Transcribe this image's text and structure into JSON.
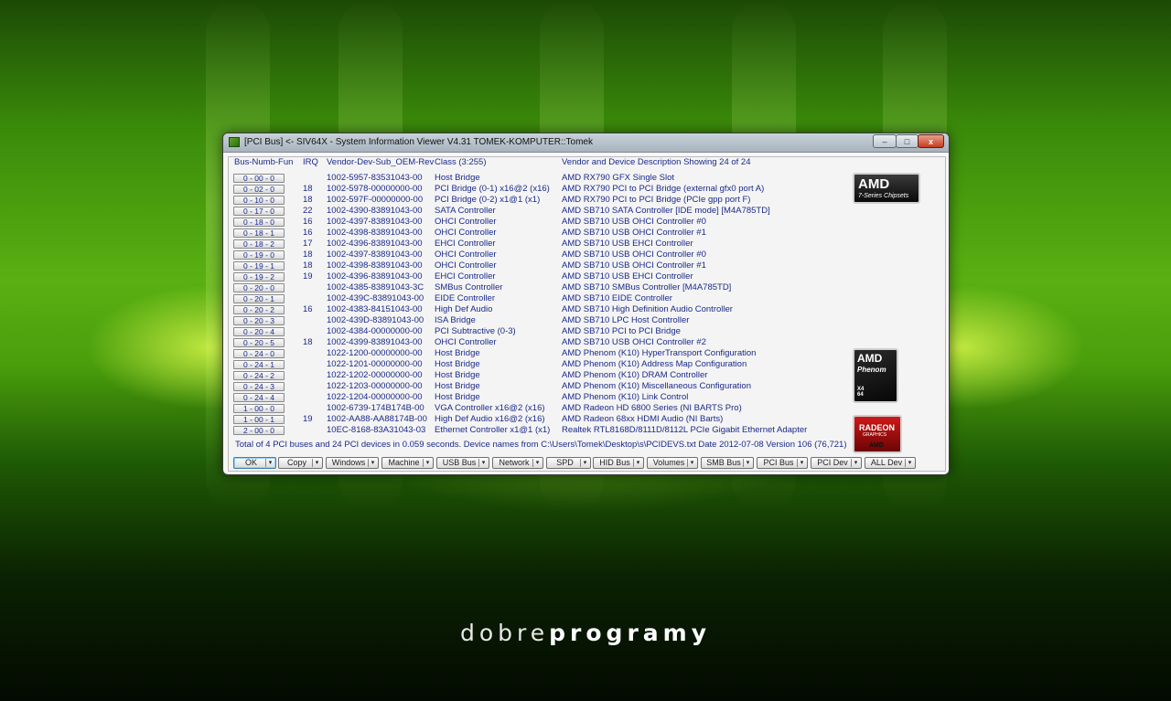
{
  "window": {
    "title": "[PCI Bus] <- SIV64X - System Information Viewer V4.31 TOMEK-KOMPUTER::Tomek",
    "min_symbol": "–",
    "max_symbol": "□",
    "close_symbol": "x"
  },
  "headers": {
    "bus": "Bus-Numb-Fun",
    "irq": "IRQ",
    "vendor": "Vendor-Dev-Sub_OEM-Rev",
    "class": "Class (3:255)",
    "description": "Vendor and Device Description  Showing 24 of 24"
  },
  "rows": [
    {
      "bus": "0 - 00 - 0",
      "irq": "",
      "vendor": "1002-5957-83531043-00",
      "class": "Host Bridge",
      "desc": "AMD RX790 GFX Single Slot"
    },
    {
      "bus": "0 - 02 - 0",
      "irq": "18",
      "vendor": "1002-5978-00000000-00",
      "class": "PCI Bridge (0-1) x16@2 (x16)",
      "desc": "AMD RX790 PCI to PCI Bridge (external gfx0 port A)"
    },
    {
      "bus": "0 - 10 - 0",
      "irq": "18",
      "vendor": "1002-597F-00000000-00",
      "class": "PCI Bridge (0-2) x1@1 (x1)",
      "desc": "AMD RX790 PCI to PCI Bridge (PCIe gpp port F)"
    },
    {
      "bus": "0 - 17 - 0",
      "irq": "22",
      "vendor": "1002-4390-83891043-00",
      "class": "SATA Controller",
      "desc": "AMD SB710 SATA Controller [IDE mode] [M4A785TD]"
    },
    {
      "bus": "0 - 18 - 0",
      "irq": "16",
      "vendor": "1002-4397-83891043-00",
      "class": "OHCI Controller",
      "desc": "AMD SB710 USB OHCI Controller #0"
    },
    {
      "bus": "0 - 18 - 1",
      "irq": "16",
      "vendor": "1002-4398-83891043-00",
      "class": "OHCI Controller",
      "desc": "AMD SB710 USB OHCI Controller #1"
    },
    {
      "bus": "0 - 18 - 2",
      "irq": "17",
      "vendor": "1002-4396-83891043-00",
      "class": "EHCI Controller",
      "desc": "AMD SB710 USB EHCI Controller"
    },
    {
      "bus": "0 - 19 - 0",
      "irq": "18",
      "vendor": "1002-4397-83891043-00",
      "class": "OHCI Controller",
      "desc": "AMD SB710 USB OHCI Controller #0"
    },
    {
      "bus": "0 - 19 - 1",
      "irq": "18",
      "vendor": "1002-4398-83891043-00",
      "class": "OHCI Controller",
      "desc": "AMD SB710 USB OHCI Controller #1"
    },
    {
      "bus": "0 - 19 - 2",
      "irq": "19",
      "vendor": "1002-4396-83891043-00",
      "class": "EHCI Controller",
      "desc": "AMD SB710 USB EHCI Controller"
    },
    {
      "bus": "0 - 20 - 0",
      "irq": "",
      "vendor": "1002-4385-83891043-3C",
      "class": "SMBus Controller",
      "desc": "AMD SB710 SMBus Controller [M4A785TD]"
    },
    {
      "bus": "0 - 20 - 1",
      "irq": "",
      "vendor": "1002-439C-83891043-00",
      "class": "EIDE Controller",
      "desc": "AMD SB710 EIDE Controller"
    },
    {
      "bus": "0 - 20 - 2",
      "irq": "16",
      "vendor": "1002-4383-84151043-00",
      "class": "High Def Audio",
      "desc": "AMD SB710 High Definition Audio Controller"
    },
    {
      "bus": "0 - 20 - 3",
      "irq": "",
      "vendor": "1002-439D-83891043-00",
      "class": "ISA Bridge",
      "desc": "AMD SB710 LPC Host Controller"
    },
    {
      "bus": "0 - 20 - 4",
      "irq": "",
      "vendor": "1002-4384-00000000-00",
      "class": "PCI Subtractive (0-3)",
      "desc": "AMD SB710 PCI to PCI Bridge"
    },
    {
      "bus": "0 - 20 - 5",
      "irq": "18",
      "vendor": "1002-4399-83891043-00",
      "class": "OHCI Controller",
      "desc": "AMD SB710 USB OHCI Controller #2"
    },
    {
      "bus": "0 - 24 - 0",
      "irq": "",
      "vendor": "1022-1200-00000000-00",
      "class": "Host Bridge",
      "desc": "AMD Phenom (K10) HyperTransport Configuration"
    },
    {
      "bus": "0 - 24 - 1",
      "irq": "",
      "vendor": "1022-1201-00000000-00",
      "class": "Host Bridge",
      "desc": "AMD Phenom (K10) Address Map Configuration"
    },
    {
      "bus": "0 - 24 - 2",
      "irq": "",
      "vendor": "1022-1202-00000000-00",
      "class": "Host Bridge",
      "desc": "AMD Phenom (K10) DRAM Controller"
    },
    {
      "bus": "0 - 24 - 3",
      "irq": "",
      "vendor": "1022-1203-00000000-00",
      "class": "Host Bridge",
      "desc": "AMD Phenom (K10) Miscellaneous Configuration"
    },
    {
      "bus": "0 - 24 - 4",
      "irq": "",
      "vendor": "1022-1204-00000000-00",
      "class": "Host Bridge",
      "desc": "AMD Phenom (K10) Link Control"
    },
    {
      "bus": "1 - 00 - 0",
      "irq": "",
      "vendor": "1002-6739-174B174B-00",
      "class": "VGA Controller x16@2 (x16)",
      "desc": "AMD Radeon HD 6800 Series (NI BARTS Pro)"
    },
    {
      "bus": "1 - 00 - 1",
      "irq": "19",
      "vendor": "1002-AA88-AA88174B-00",
      "class": "High Def Audio x16@2 (x16)",
      "desc": "AMD Radeon 68xx HDMI Audio (NI Barts)"
    },
    {
      "bus": "2 - 00 - 0",
      "irq": "",
      "vendor": "10EC-8168-83A31043-03",
      "class": "Ethernet Controller x1@1 (x1)",
      "desc": "Realtek RTL8168D/8111D/8112L PCIe Gigabit Ethernet Adapter"
    }
  ],
  "status_line": "Total of 4 PCI buses and 24 PCI devices in 0.059 seconds.  Device names from C:\\Users\\Tomek\\Desktop\\s\\PCIDEVS.txt  Date 2012-07-08 Version 106 (76,721)",
  "buttons": [
    "OK",
    "Copy",
    "Windows",
    "Machine",
    "USB Bus",
    "Network",
    "SPD",
    "HID Bus",
    "Volumes",
    "SMB Bus",
    "PCI Bus",
    "PCI Dev",
    "ALL Dev"
  ],
  "logos": {
    "amd_chipset": {
      "brand": "AMD",
      "sub": "7-Series Chipsets"
    },
    "amd_phenom": {
      "brand": "AMD",
      "sub": "Phenom",
      "tag": "X4 64"
    },
    "radeon": {
      "brand": "RADEON",
      "sub": "GRAPHICS",
      "small": "AMD"
    }
  },
  "brand": {
    "light": "dobre",
    "bold": "programy"
  },
  "colors": {
    "accent_text": "#1a2a8a",
    "close_button": "#c53a1e",
    "background_green": "#4a9e0c"
  }
}
